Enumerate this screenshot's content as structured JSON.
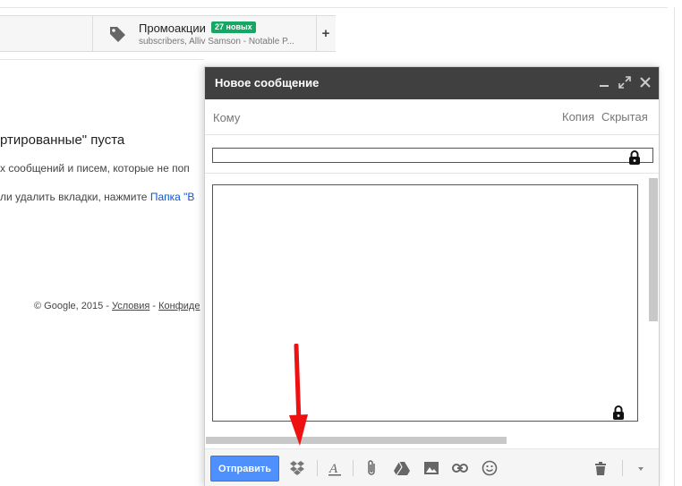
{
  "tabs": {
    "promo": {
      "title": "Промоакции",
      "badge": "27 новых",
      "snippet": "subscribers, Alliv Samson - Notable P...",
      "icon": "tag-icon"
    },
    "add_label": "+"
  },
  "empty_state": {
    "title": "ртированные\" пуста",
    "line1": "х сообщений и писем, которые не поп",
    "line2_prefix": "ли удалить вкладки, нажмите ",
    "line2_link": "Папка \"В"
  },
  "footer": {
    "copyright": "© Google, 2015 - ",
    "terms": "Условия",
    "sep": " - ",
    "privacy": "Конфиде"
  },
  "compose": {
    "title": "Новое сообщение",
    "to_label": "Кому",
    "cc_label": "Копия",
    "bcc_label": "Скрытая",
    "subject_value": "",
    "body_value": "",
    "send_label": "Отправить",
    "toolbar_icons": [
      "dropbox-icon",
      "format-text-icon",
      "attach-icon",
      "drive-icon",
      "photo-icon",
      "link-icon",
      "emoji-icon",
      "trash-icon",
      "more-options-icon"
    ],
    "header_icons": [
      "minimize-icon",
      "expand-icon",
      "close-icon"
    ]
  },
  "colors": {
    "header_bg": "#404040",
    "send_button": "#4d90fe",
    "badge": "#16a765",
    "annotation_arrow": "#ee1111",
    "link": "#1155cc"
  }
}
